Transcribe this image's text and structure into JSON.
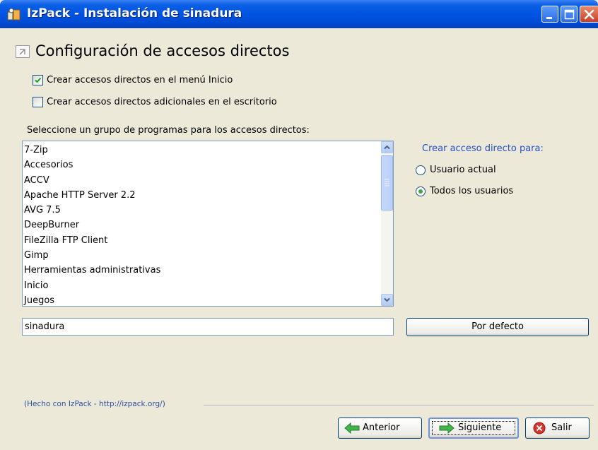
{
  "window": {
    "title": "IzPack - Instalación de sinadura"
  },
  "page": {
    "title": "Configuración de accesos directos"
  },
  "options": {
    "start_menu_label": "Crear accesos directos en el menú Inicio",
    "start_menu_checked": true,
    "desktop_label": "Crear accesos directos adicionales en el escritorio",
    "desktop_checked": false
  },
  "program_group": {
    "label": "Seleccione un grupo de programas para los accesos directos:",
    "items": [
      "7-Zip",
      "Accesorios",
      "ACCV",
      "Apache HTTP Server 2.2",
      "AVG 7.5",
      "DeepBurner",
      "FileZilla FTP Client",
      "Gimp",
      "Herramientas administrativas",
      "Inicio",
      "Juegos"
    ],
    "name_value": "sinadura",
    "default_button": "Por defecto"
  },
  "shortcut_for": {
    "label": "Crear acceso directo para:",
    "current_user": "Usuario actual",
    "all_users": "Todos los usuarios",
    "selected": "all_users"
  },
  "footer": {
    "credit": "(Hecho con IzPack - http://izpack.org/)",
    "prev_button": "Anterior",
    "next_button": "Siguiente",
    "exit_button": "Salir"
  }
}
